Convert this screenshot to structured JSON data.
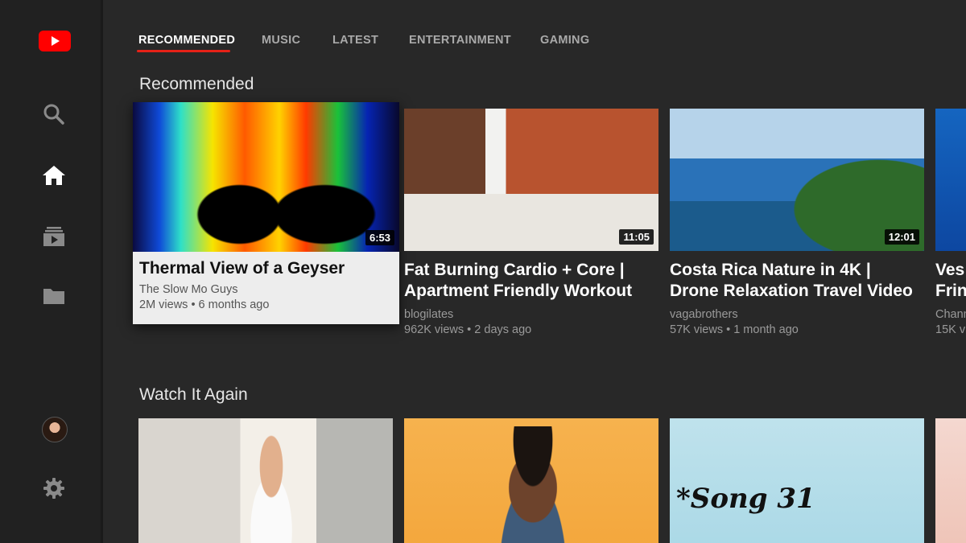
{
  "app": {
    "name": "YouTube",
    "brand_color": "#ff0000",
    "accent_color": "#e62117"
  },
  "sidebar": {
    "items": [
      {
        "name": "youtube-logo-icon"
      },
      {
        "name": "search-icon"
      },
      {
        "name": "home-icon"
      },
      {
        "name": "subscriptions-icon"
      },
      {
        "name": "library-folder-icon"
      },
      {
        "name": "account-avatar"
      },
      {
        "name": "settings-gear-icon"
      }
    ]
  },
  "tabs": [
    {
      "label": "RECOMMENDED",
      "active": true
    },
    {
      "label": "MUSIC"
    },
    {
      "label": "LATEST"
    },
    {
      "label": "ENTERTAINMENT"
    },
    {
      "label": "GAMING"
    }
  ],
  "sections": {
    "recommended": {
      "title": "Recommended",
      "videos": [
        {
          "title": "Thermal View of a Geyser",
          "channel": "The Slow Mo Guys",
          "stats": "2M views • 6 months ago",
          "duration": "6:53"
        },
        {
          "title_line1": "Fat Burning Cardio + Core |",
          "title_line2": "Apartment Friendly Workout",
          "channel": "blogilates",
          "stats": "962K views • 2 days ago",
          "duration": "11:05"
        },
        {
          "title_line1": "Costa Rica Nature in 4K |",
          "title_line2": "Drone Relaxation Travel Video",
          "channel": "vagabrothers",
          "stats": "57K views • 1 month ago",
          "duration": "12:01"
        },
        {
          "title_line1": "Ves",
          "title_line2": "Frin",
          "channel": "Chann",
          "stats": "15K v"
        }
      ]
    },
    "watch_again": {
      "title": "Watch It Again",
      "videos": [
        {
          "thumb": "kitchen"
        },
        {
          "thumb": "portrait"
        },
        {
          "thumb": "song",
          "thumb_text": "*Song 31"
        },
        {
          "thumb": "pink"
        }
      ]
    }
  }
}
